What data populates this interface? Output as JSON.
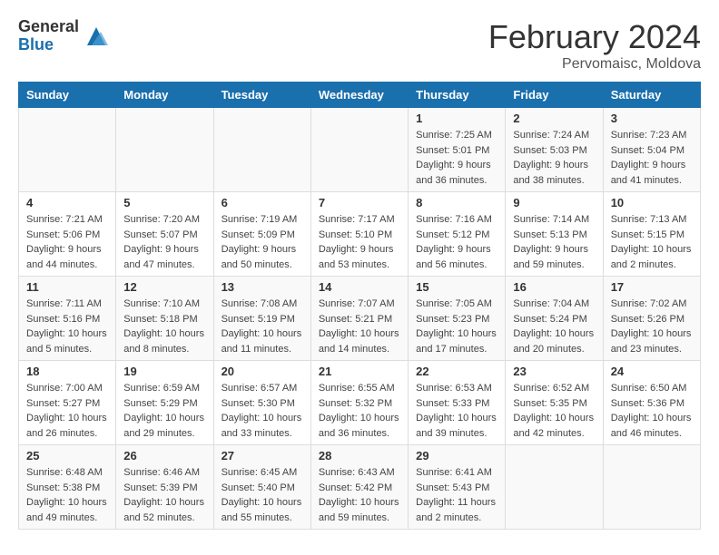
{
  "logo": {
    "general": "General",
    "blue": "Blue"
  },
  "title": "February 2024",
  "subtitle": "Pervomaisc, Moldova",
  "headers": [
    "Sunday",
    "Monday",
    "Tuesday",
    "Wednesday",
    "Thursday",
    "Friday",
    "Saturday"
  ],
  "weeks": [
    [
      {
        "day": "",
        "info": ""
      },
      {
        "day": "",
        "info": ""
      },
      {
        "day": "",
        "info": ""
      },
      {
        "day": "",
        "info": ""
      },
      {
        "day": "1",
        "info": "Sunrise: 7:25 AM\nSunset: 5:01 PM\nDaylight: 9 hours\nand 36 minutes."
      },
      {
        "day": "2",
        "info": "Sunrise: 7:24 AM\nSunset: 5:03 PM\nDaylight: 9 hours\nand 38 minutes."
      },
      {
        "day": "3",
        "info": "Sunrise: 7:23 AM\nSunset: 5:04 PM\nDaylight: 9 hours\nand 41 minutes."
      }
    ],
    [
      {
        "day": "4",
        "info": "Sunrise: 7:21 AM\nSunset: 5:06 PM\nDaylight: 9 hours\nand 44 minutes."
      },
      {
        "day": "5",
        "info": "Sunrise: 7:20 AM\nSunset: 5:07 PM\nDaylight: 9 hours\nand 47 minutes."
      },
      {
        "day": "6",
        "info": "Sunrise: 7:19 AM\nSunset: 5:09 PM\nDaylight: 9 hours\nand 50 minutes."
      },
      {
        "day": "7",
        "info": "Sunrise: 7:17 AM\nSunset: 5:10 PM\nDaylight: 9 hours\nand 53 minutes."
      },
      {
        "day": "8",
        "info": "Sunrise: 7:16 AM\nSunset: 5:12 PM\nDaylight: 9 hours\nand 56 minutes."
      },
      {
        "day": "9",
        "info": "Sunrise: 7:14 AM\nSunset: 5:13 PM\nDaylight: 9 hours\nand 59 minutes."
      },
      {
        "day": "10",
        "info": "Sunrise: 7:13 AM\nSunset: 5:15 PM\nDaylight: 10 hours\nand 2 minutes."
      }
    ],
    [
      {
        "day": "11",
        "info": "Sunrise: 7:11 AM\nSunset: 5:16 PM\nDaylight: 10 hours\nand 5 minutes."
      },
      {
        "day": "12",
        "info": "Sunrise: 7:10 AM\nSunset: 5:18 PM\nDaylight: 10 hours\nand 8 minutes."
      },
      {
        "day": "13",
        "info": "Sunrise: 7:08 AM\nSunset: 5:19 PM\nDaylight: 10 hours\nand 11 minutes."
      },
      {
        "day": "14",
        "info": "Sunrise: 7:07 AM\nSunset: 5:21 PM\nDaylight: 10 hours\nand 14 minutes."
      },
      {
        "day": "15",
        "info": "Sunrise: 7:05 AM\nSunset: 5:23 PM\nDaylight: 10 hours\nand 17 minutes."
      },
      {
        "day": "16",
        "info": "Sunrise: 7:04 AM\nSunset: 5:24 PM\nDaylight: 10 hours\nand 20 minutes."
      },
      {
        "day": "17",
        "info": "Sunrise: 7:02 AM\nSunset: 5:26 PM\nDaylight: 10 hours\nand 23 minutes."
      }
    ],
    [
      {
        "day": "18",
        "info": "Sunrise: 7:00 AM\nSunset: 5:27 PM\nDaylight: 10 hours\nand 26 minutes."
      },
      {
        "day": "19",
        "info": "Sunrise: 6:59 AM\nSunset: 5:29 PM\nDaylight: 10 hours\nand 29 minutes."
      },
      {
        "day": "20",
        "info": "Sunrise: 6:57 AM\nSunset: 5:30 PM\nDaylight: 10 hours\nand 33 minutes."
      },
      {
        "day": "21",
        "info": "Sunrise: 6:55 AM\nSunset: 5:32 PM\nDaylight: 10 hours\nand 36 minutes."
      },
      {
        "day": "22",
        "info": "Sunrise: 6:53 AM\nSunset: 5:33 PM\nDaylight: 10 hours\nand 39 minutes."
      },
      {
        "day": "23",
        "info": "Sunrise: 6:52 AM\nSunset: 5:35 PM\nDaylight: 10 hours\nand 42 minutes."
      },
      {
        "day": "24",
        "info": "Sunrise: 6:50 AM\nSunset: 5:36 PM\nDaylight: 10 hours\nand 46 minutes."
      }
    ],
    [
      {
        "day": "25",
        "info": "Sunrise: 6:48 AM\nSunset: 5:38 PM\nDaylight: 10 hours\nand 49 minutes."
      },
      {
        "day": "26",
        "info": "Sunrise: 6:46 AM\nSunset: 5:39 PM\nDaylight: 10 hours\nand 52 minutes."
      },
      {
        "day": "27",
        "info": "Sunrise: 6:45 AM\nSunset: 5:40 PM\nDaylight: 10 hours\nand 55 minutes."
      },
      {
        "day": "28",
        "info": "Sunrise: 6:43 AM\nSunset: 5:42 PM\nDaylight: 10 hours\nand 59 minutes."
      },
      {
        "day": "29",
        "info": "Sunrise: 6:41 AM\nSunset: 5:43 PM\nDaylight: 11 hours\nand 2 minutes."
      },
      {
        "day": "",
        "info": ""
      },
      {
        "day": "",
        "info": ""
      }
    ]
  ]
}
